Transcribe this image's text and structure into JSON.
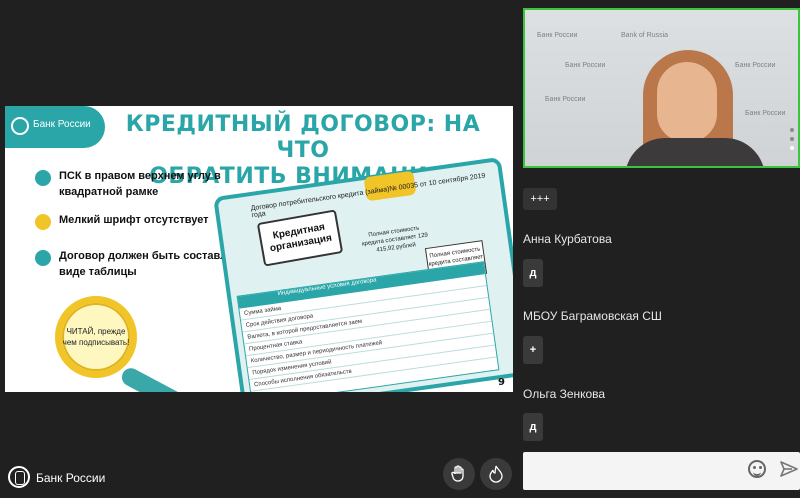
{
  "slide": {
    "brand": "Банк России",
    "title_line1": "КРЕДИТНЫЙ ДОГОВОР: НА ЧТО",
    "title_line2": "ОБРАТИТЬ ВНИМАНИЕ?",
    "bullets": [
      {
        "text": "ПСК в правом верхнем углу в квадратной рамке",
        "color": "#2aa6a8"
      },
      {
        "text": "Мелкий шрифт отсутствует",
        "color": "#f1c428"
      },
      {
        "text": "Договор должен быть составлен в виде таблицы",
        "color": "#2aa6a8"
      }
    ],
    "magnifier_text": "ЧИТАЙ, прежде чем подписывать!",
    "doc_header": "Договор потребительского кредита (займа)№ 00035 от 10 сентября 2019 года",
    "stamp_text": "Кредитная организация",
    "psk_text": "Полная стоимость кредита составляет 129 415,92 рублей",
    "psk_box_text": "Полная стоимость кредита составляет 17,900%",
    "table_header": "Индивидуальные условия договора",
    "table_rows": [
      "Сумма займа",
      "Срок действия договора",
      "Валюта, в которой предоставляется заем",
      "Процентная ставка",
      "Количество, размер и периодичность платежей",
      "Порядок изменения условий",
      "Способы исполнения обязательств"
    ],
    "page_number": "9"
  },
  "webcam": {
    "background_logos": [
      "Банк России",
      "Bank of Russia",
      "Банк России",
      "Банк России",
      "Банк России",
      "Банк России"
    ]
  },
  "chat": {
    "reactions_chip": "+++",
    "messages": [
      {
        "author": "Анна Курбатова",
        "text": "д"
      },
      {
        "author": "МБОУ Баграмовская СШ",
        "text": "+"
      },
      {
        "author": "Ольга Зенкова",
        "text": "д"
      }
    ],
    "input_placeholder": ""
  },
  "footer": {
    "brand": "Банк России",
    "raise_hand_icon": "hand-icon",
    "fire_icon": "flame-icon"
  },
  "colors": {
    "accent": "#2aa6a8",
    "yellow": "#f1c428",
    "background": "#202020"
  }
}
